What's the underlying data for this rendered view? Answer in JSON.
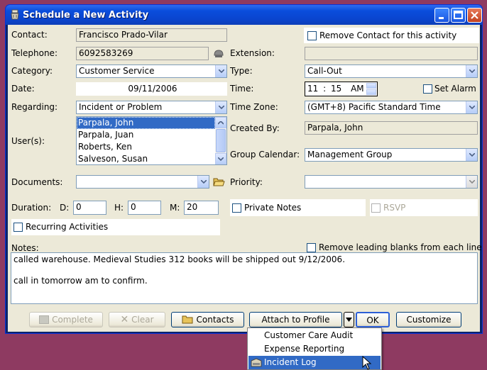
{
  "window": {
    "title": "Schedule a New Activity"
  },
  "labels": {
    "contact": "Contact:",
    "telephone": "Telephone:",
    "extension": "Extension:",
    "category": "Category:",
    "type": "Type:",
    "date": "Date:",
    "time": "Time:",
    "regarding": "Regarding:",
    "time_zone": "Time Zone:",
    "users": "User(s):",
    "created_by": "Created By:",
    "group_calendar": "Group Calendar:",
    "documents": "Documents:",
    "priority": "Priority:",
    "duration": "Duration:",
    "d": "D:",
    "h": "H:",
    "m": "M:",
    "notes": "Notes:"
  },
  "fields": {
    "contact": "Francisco Prado-Vilar",
    "telephone": "6092583269",
    "extension": "",
    "category": "Customer Service",
    "type": "Call-Out",
    "date": "09/11/2006",
    "time_hour": "11",
    "time_sep": ":",
    "time_min": "15",
    "time_ampm": "AM",
    "regarding": "Incident or Problem",
    "time_zone": "(GMT+8) Pacific Standard Time",
    "created_by": "Parpala, John",
    "group_calendar": "Management Group",
    "documents": "",
    "priority": "",
    "duration_d": "0",
    "duration_h": "0",
    "duration_m": "20"
  },
  "users": [
    {
      "name": "Parpala, John",
      "selected": true
    },
    {
      "name": "Parpala, Juan",
      "selected": false
    },
    {
      "name": "Roberts, Ken",
      "selected": false
    },
    {
      "name": "Salveson, Susan",
      "selected": false
    }
  ],
  "checkboxes": {
    "remove_contact": {
      "label": "Remove Contact for this activity",
      "checked": false
    },
    "set_alarm": {
      "label": "Set Alarm",
      "checked": false
    },
    "private_notes": {
      "label": "Private Notes",
      "checked": false
    },
    "rsvp": {
      "label": "RSVP",
      "checked": false,
      "disabled": true
    },
    "recurring": {
      "label": "Recurring Activities",
      "checked": false
    },
    "remove_blanks": {
      "label": "Remove leading blanks from each line",
      "checked": false
    }
  },
  "notes": {
    "line1": "called warehouse. Medieval Studies 312 books will be shipped out 9/12/2006.",
    "line2": "",
    "line3": "call in tomorrow am to confirm."
  },
  "buttons": {
    "complete": "Complete",
    "clear": "Clear",
    "contacts": "Contacts",
    "attach_to_profile": "Attach to Profile",
    "ok": "OK",
    "customize": "Customize"
  },
  "attach_menu": {
    "items": [
      "Customer Care Audit",
      "Expense Reporting",
      "Incident Log"
    ],
    "highlighted": "Incident Log"
  },
  "colors": {
    "desktop": "#8e3a61",
    "titlebar": "#0a4ddc",
    "dialog": "#ece9d8",
    "selection": "#316ac5"
  }
}
